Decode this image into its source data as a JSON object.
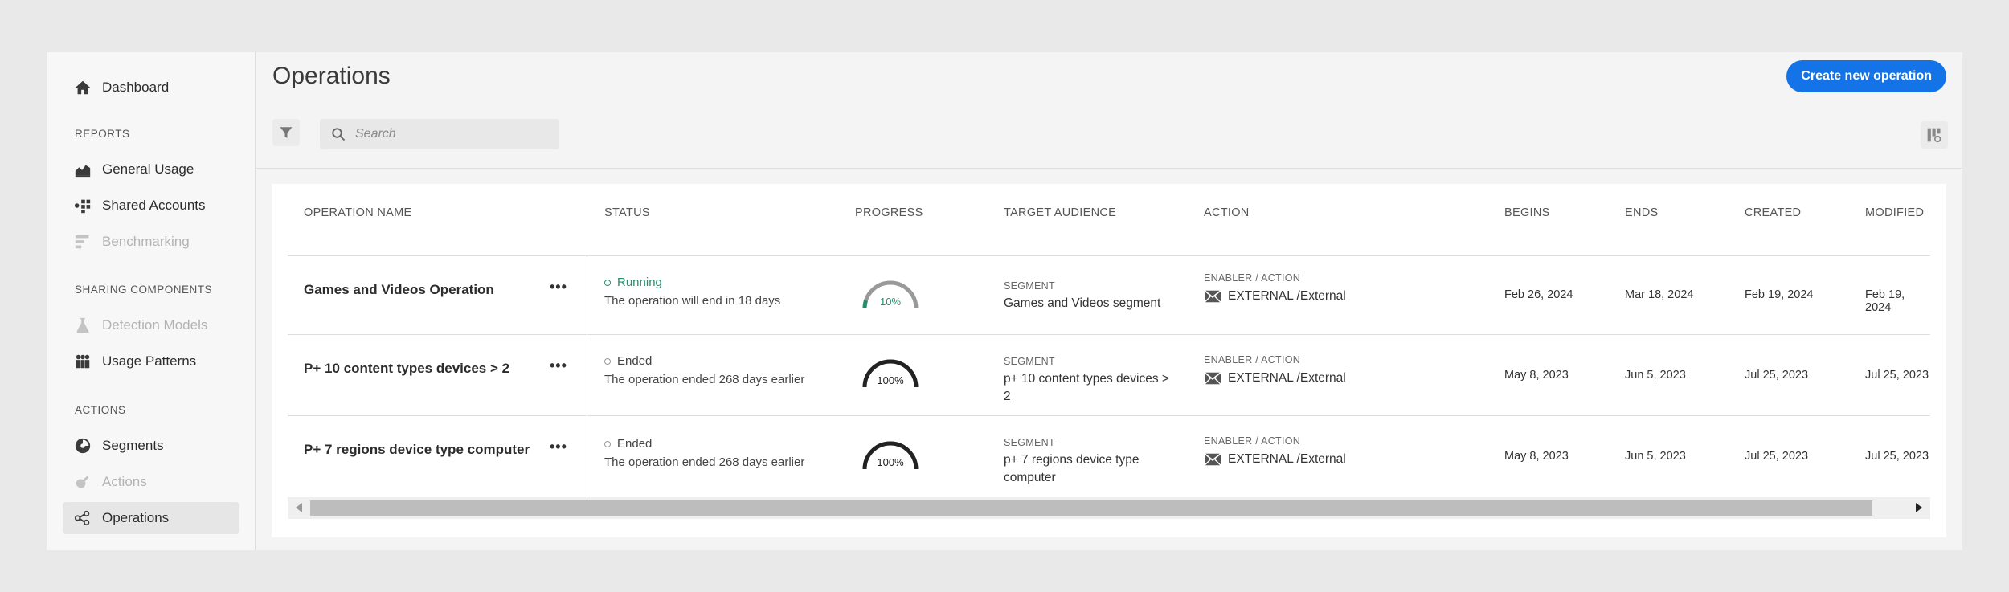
{
  "sidebar": {
    "dashboard": "Dashboard",
    "sections": [
      {
        "label": "REPORTS"
      },
      {
        "label": "SHARING COMPONENTS"
      },
      {
        "label": "ACTIONS"
      }
    ],
    "items": [
      {
        "label": "General Usage",
        "disabled": false
      },
      {
        "label": "Shared Accounts",
        "disabled": false
      },
      {
        "label": "Benchmarking",
        "disabled": true
      },
      {
        "label": "Detection Models",
        "disabled": true
      },
      {
        "label": "Usage Patterns",
        "disabled": false
      },
      {
        "label": "Segments",
        "disabled": false
      },
      {
        "label": "Actions",
        "disabled": true
      },
      {
        "label": "Operations",
        "disabled": false,
        "active": true
      }
    ]
  },
  "header": {
    "title": "Operations",
    "create_label": "Create new operation",
    "search_placeholder": "Search"
  },
  "table": {
    "columns": [
      "OPERATION NAME",
      "STATUS",
      "PROGRESS",
      "TARGET AUDIENCE",
      "ACTION",
      "BEGINS",
      "ENDS",
      "CREATED",
      "MODIFIED"
    ],
    "rows": [
      {
        "name": "Games and Videos Operation",
        "more": "•••",
        "status": "Running",
        "status_desc": "The operation will end in 18 days",
        "progress": "10%",
        "progress_value": 0.1,
        "segment_label": "SEGMENT",
        "segment": "Games and Videos segment",
        "action_label": "ENABLER / ACTION",
        "action": "EXTERNAL /External",
        "begins": "Feb 26, 2024",
        "ends": "Mar 18, 2024",
        "created": "Feb 19, 2024",
        "modified": "Feb 19, 2024"
      },
      {
        "name": "P+ 10 content types devices > 2",
        "more": "•••",
        "status": "Ended",
        "status_desc": "The operation ended 268 days earlier",
        "progress": "100%",
        "progress_value": 1.0,
        "segment_label": "SEGMENT",
        "segment": "p+ 10 content types devices > 2",
        "action_label": "ENABLER / ACTION",
        "action": "EXTERNAL /External",
        "begins": "May 8, 2023",
        "ends": "Jun 5, 2023",
        "created": "Jul 25, 2023",
        "modified": "Jul 25, 2023"
      },
      {
        "name": "P+ 7 regions device type computer",
        "more": "•••",
        "status": "Ended",
        "status_desc": "The operation ended 268 days earlier",
        "progress": "100%",
        "progress_value": 1.0,
        "segment_label": "SEGMENT",
        "segment": "p+ 7 regions device type computer",
        "action_label": "ENABLER / ACTION",
        "action": "EXTERNAL /External",
        "begins": "May 8, 2023",
        "ends": "Jun 5, 2023",
        "created": "Jul 25, 2023",
        "modified": "Jul 25, 2023"
      }
    ]
  },
  "colors": {
    "accent": "#1473e6",
    "running": "#268e6c",
    "ended": "#222222"
  }
}
